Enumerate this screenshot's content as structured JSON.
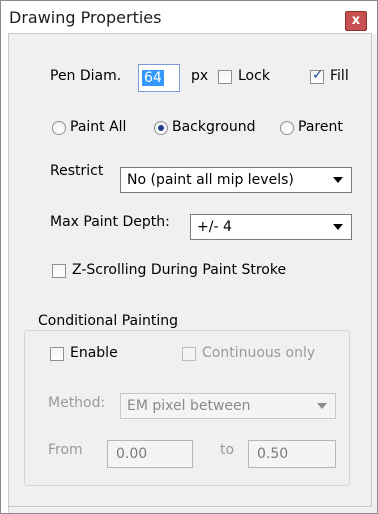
{
  "window": {
    "title": "Drawing Properties",
    "close_glyph": "x"
  },
  "pen": {
    "label": "Pen Diam.",
    "value": "64",
    "unit": "px",
    "lock_label": "Lock",
    "lock_checked": false,
    "fill_label": "Fill",
    "fill_checked": true
  },
  "paint_mode": {
    "options": [
      "Paint All",
      "Background",
      "Parent"
    ],
    "selected": "Background"
  },
  "restrict": {
    "label": "Restrict",
    "value": "No (paint all mip levels)"
  },
  "max_depth": {
    "label": "Max Paint Depth:",
    "value": "+/- 4"
  },
  "z_scroll": {
    "label": "Z-Scrolling During Paint Stroke",
    "checked": false
  },
  "conditional": {
    "group_label": "Conditional Painting",
    "enable_label": "Enable",
    "enable_checked": false,
    "continuous_label": "Continuous only",
    "continuous_checked": false,
    "method_label": "Method:",
    "method_value": "EM pixel between",
    "from_label": "From",
    "from_value": "0.00",
    "to_label": "to",
    "to_value": "0.50"
  }
}
